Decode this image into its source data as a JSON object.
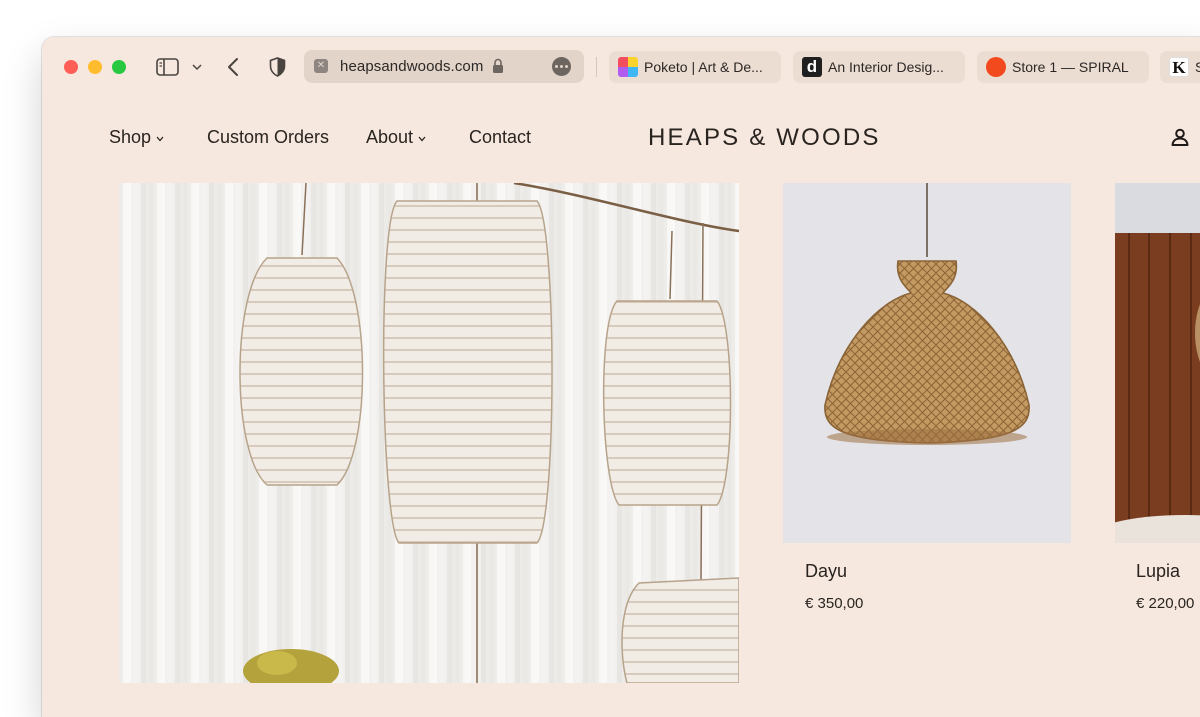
{
  "browser": {
    "address": "heapsandwoods.com",
    "tabs": [
      {
        "title": "Poketo | Art & De...",
        "favicon": "poketo-favicon"
      },
      {
        "title": "An Interior Desig...",
        "favicon": "d-favicon"
      },
      {
        "title": "Store 1 — SPIRAL",
        "favicon": "spiral-favicon"
      },
      {
        "title": "S",
        "favicon": "k-favicon",
        "favicon_letter": "K"
      }
    ],
    "colors": {
      "chrome": "#f6e8df",
      "address_bg": "#e3d4ca",
      "tab_bg": "#ecddd3"
    }
  },
  "site": {
    "brand": "HEAPS & WOODS",
    "nav": {
      "shop": "Shop",
      "custom_orders": "Custom Orders",
      "about": "About",
      "contact": "Contact"
    },
    "colors": {
      "background": "#f6e8df",
      "text": "#2a2420"
    }
  },
  "products": [
    {
      "name": "Dayu",
      "price": "€ 350,00"
    },
    {
      "name": "Lupia",
      "price": "€ 220,00"
    }
  ]
}
